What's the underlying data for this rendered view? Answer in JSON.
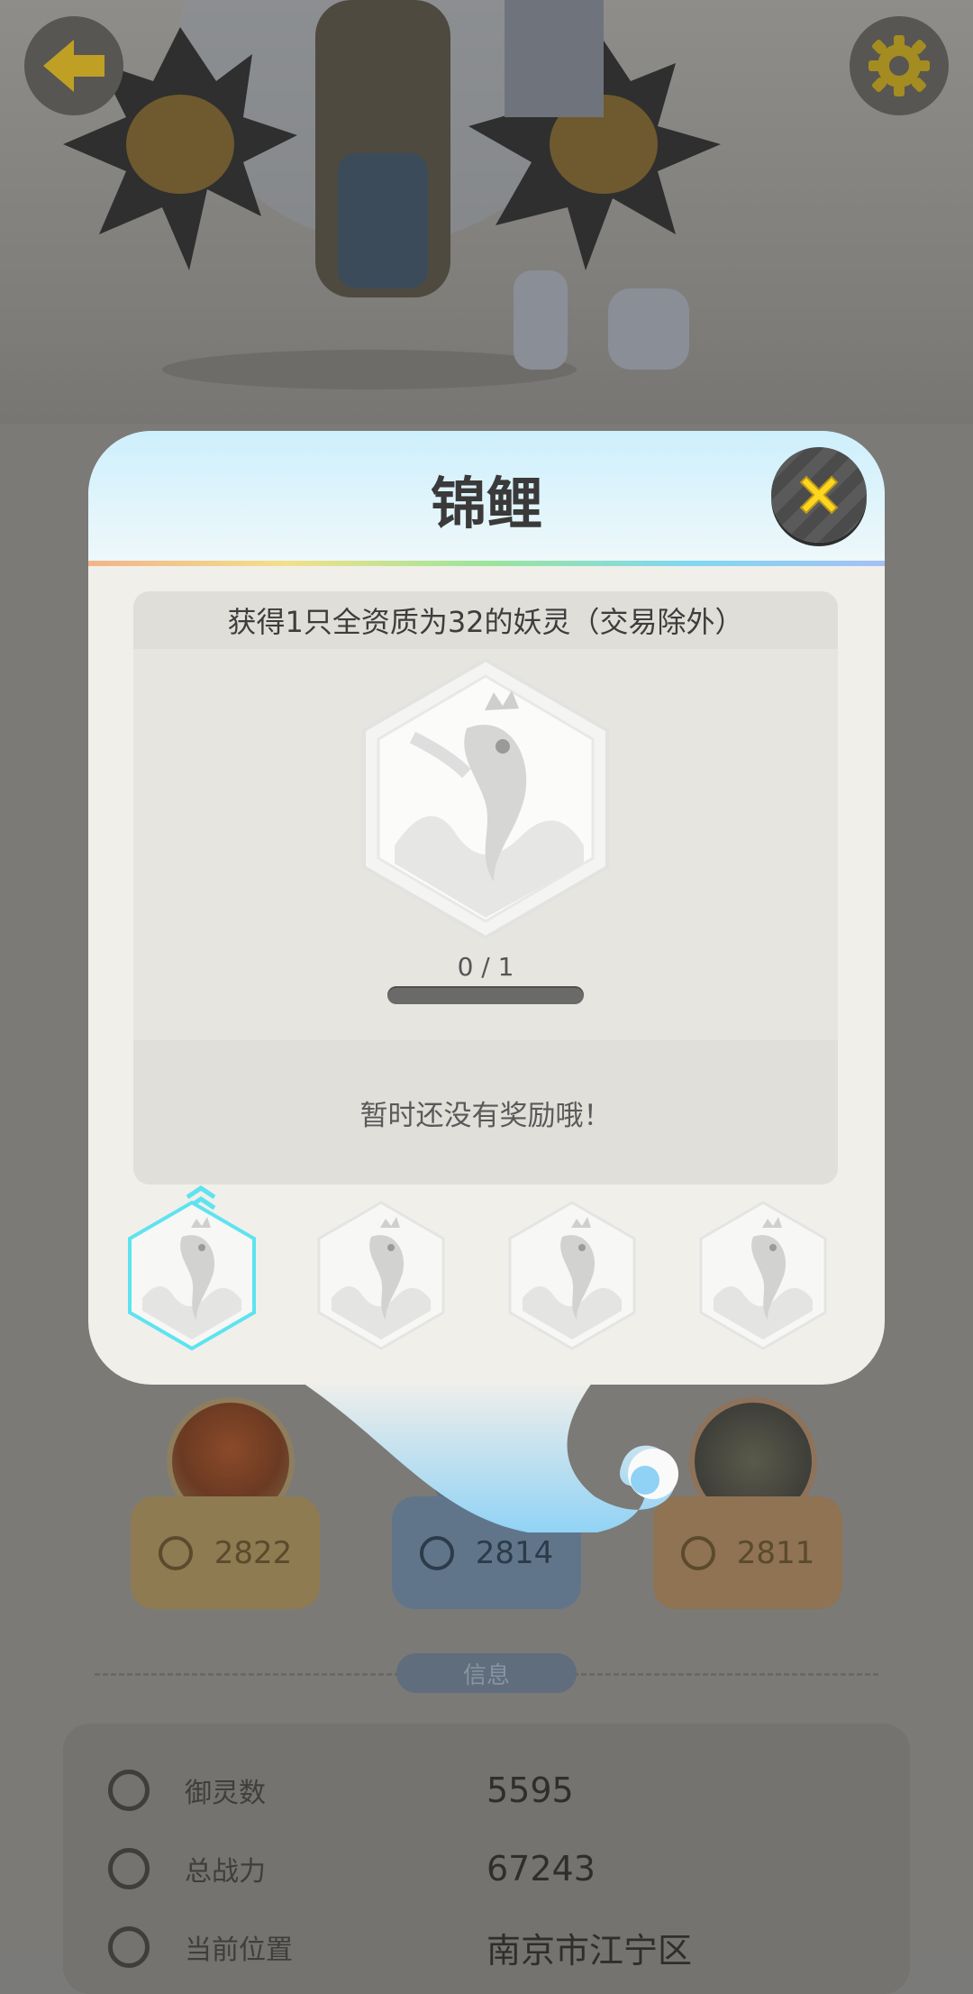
{
  "top_bar": {
    "back_icon": "arrow-left-icon",
    "settings_icon": "gear-icon",
    "accent_color": "#e8c21a"
  },
  "modal": {
    "title": "锦鲤",
    "close_icon": "close-x-icon",
    "task": {
      "description": "获得1只全资质为32的妖灵（交易除外）",
      "progress_text": "0 / 1",
      "progress_current": 0,
      "progress_total": 1,
      "reward_message": "暂时还没有奖励哦！"
    },
    "tiers": [
      {
        "icon": "koi-badge-icon",
        "selected": true
      },
      {
        "icon": "koi-badge-icon",
        "selected": false
      },
      {
        "icon": "koi-badge-icon",
        "selected": false
      },
      {
        "icon": "koi-badge-icon",
        "selected": false
      }
    ]
  },
  "rankings": [
    {
      "value": "2822"
    },
    {
      "value": "2814"
    },
    {
      "value": "2811"
    }
  ],
  "info": {
    "section_title": "信息",
    "rows": [
      {
        "icon": "spirit-count-icon",
        "label": "御灵数",
        "value": "5595"
      },
      {
        "icon": "power-icon",
        "label": "总战力",
        "value": "67243"
      },
      {
        "icon": "location-pin-icon",
        "label": "当前位置",
        "value": "南京市江宁区"
      }
    ]
  }
}
